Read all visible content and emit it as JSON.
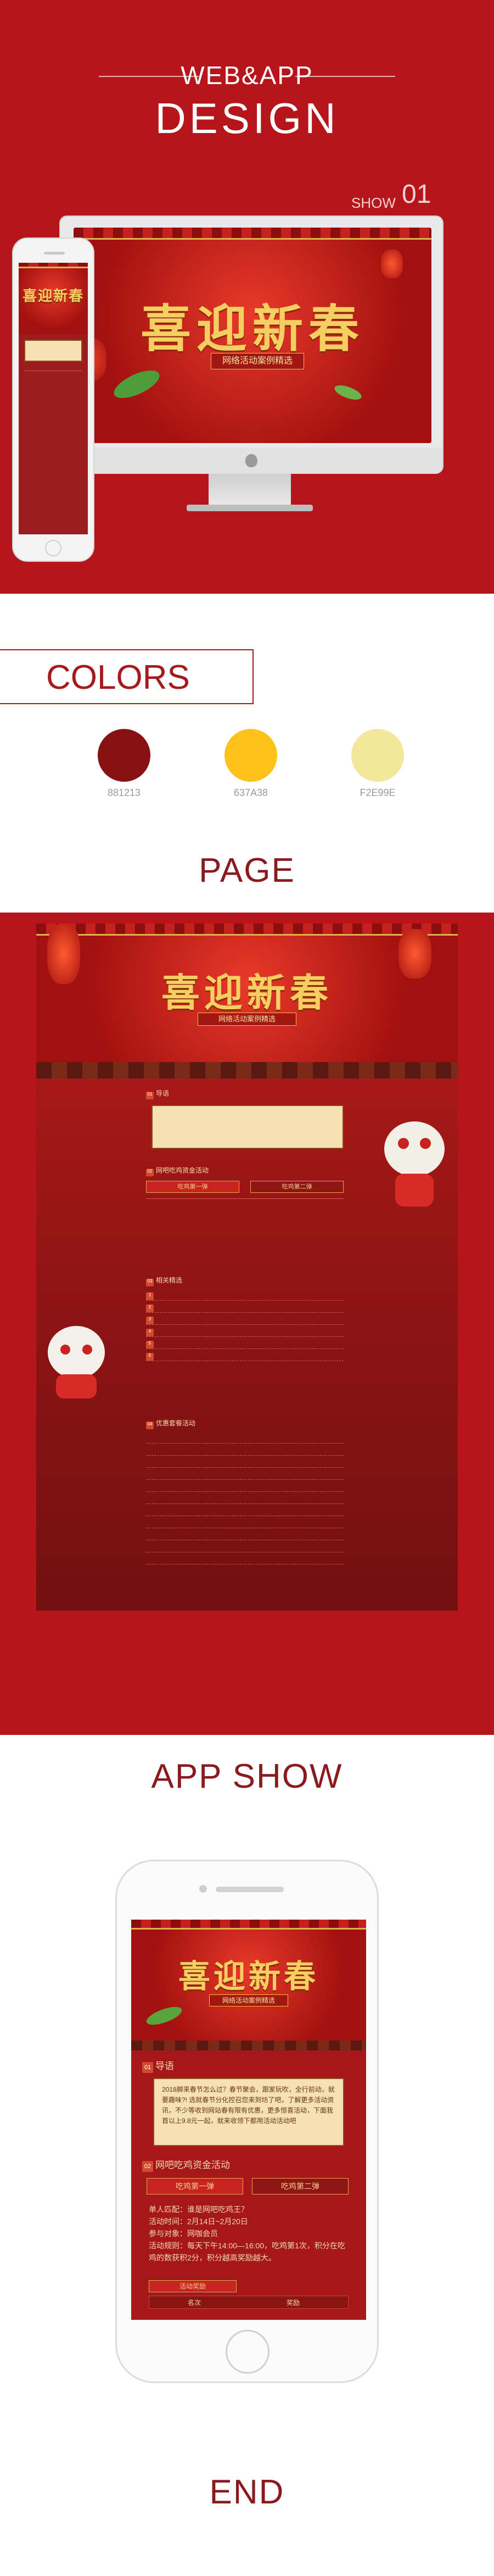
{
  "header": {
    "subtitle": "WEB&APP",
    "title": "DESIGN",
    "show_label": "SHOW",
    "show_number": "01"
  },
  "festive": {
    "title": "喜迎新春",
    "subtitle": "网络活动案例精选"
  },
  "colors": {
    "heading": "COLORS",
    "swatches": [
      {
        "hex": "#881213",
        "label": "881213"
      },
      {
        "hex": "#ffc21a",
        "label": "637A38"
      },
      {
        "hex": "#f2e79a",
        "label": "F2E99E"
      }
    ]
  },
  "sections": {
    "page": "PAGE",
    "app_show": "APP SHOW",
    "end": "END"
  },
  "app": {
    "sec1_num": "01",
    "sec1_title": "导语",
    "intro": "2018脚来春节怎么过？春节聚会，跟家玩吹，全行前动，就要趣味?! 选就春节分化控召您来到坊了吧，了解更多活动资讯，不少等收到网站春有限有优惠，更多惊喜活动，下面我首以上9.8元一起，就来收领下都用活动活动吧",
    "sec2_num": "02",
    "sec2_title": "网吧吃鸡资金活动",
    "tab1": "吃鸡第一弹",
    "tab2": "吃鸡第二弹",
    "rows": [
      "单人匹配：谁是网吧吃鸡王？",
      "活动时间：2月14日~2月20日",
      "参与对象：网咖会员",
      "活动规则：每天下午14:00—16:00，吃鸡第1次，积分在吃鸡的数获积2分，积分越高奖励越大。"
    ],
    "reward_label": "活动奖励",
    "col_rank": "名次",
    "col_reward": "奖励"
  },
  "page_mock": {
    "sec1_title": "导语",
    "sec2_title": "网吧吃鸡资金活动",
    "sec3_title": "相关精选",
    "sec4_title": "优惠套餐活动",
    "tab1": "吃鸡第一弹",
    "tab2": "吃鸡第二弹"
  }
}
